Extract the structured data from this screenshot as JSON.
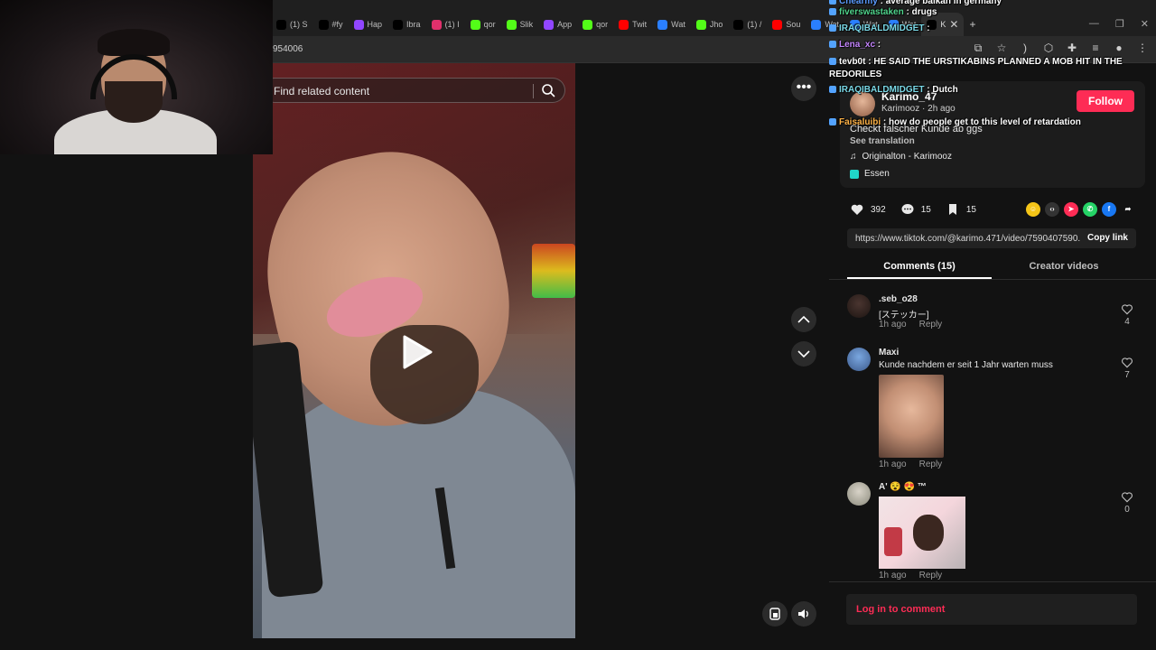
{
  "browser": {
    "tabs": [
      {
        "label": "(1) S",
        "icon": "x-icon",
        "color": "#000000"
      },
      {
        "label": "#fy",
        "icon": "tiktok-icon",
        "color": "#000000"
      },
      {
        "label": "Hap",
        "icon": "twitch-icon",
        "color": "#9146ff"
      },
      {
        "label": "Ibra",
        "icon": "tiktok-icon",
        "color": "#000000"
      },
      {
        "label": "(1) I",
        "icon": "instagram-icon",
        "color": "#e1306c"
      },
      {
        "label": "qor",
        "icon": "kick-icon",
        "color": "#53fc18"
      },
      {
        "label": "Slik",
        "icon": "kick-icon",
        "color": "#53fc18"
      },
      {
        "label": "App",
        "icon": "twitch-icon",
        "color": "#9146ff"
      },
      {
        "label": "qor",
        "icon": "kick-icon",
        "color": "#53fc18"
      },
      {
        "label": "Twit",
        "icon": "youtube-icon",
        "color": "#ff0000"
      },
      {
        "label": "Wat",
        "icon": "globe-icon",
        "color": "#2a7fff"
      },
      {
        "label": "Jho",
        "icon": "kick-icon",
        "color": "#53fc18"
      },
      {
        "label": "(1) /",
        "icon": "x-icon",
        "color": "#000000"
      },
      {
        "label": "Sou",
        "icon": "youtube-icon",
        "color": "#ff0000"
      },
      {
        "label": "Wat",
        "icon": "globe-icon",
        "color": "#2a7fff"
      },
      {
        "label": "Wat",
        "icon": "globe-icon",
        "color": "#2a7fff"
      },
      {
        "label": "Wat",
        "icon": "globe-icon",
        "color": "#2a7fff"
      },
      {
        "label": "K",
        "icon": "tiktok-icon",
        "color": "#000000",
        "active": true
      }
    ],
    "url": "954006"
  },
  "search": {
    "placeholder": "Find related content"
  },
  "post": {
    "author_display": "Karimo_47",
    "author_name": "Karimooz",
    "time_ago": "2h ago",
    "follow_label": "Follow",
    "description": "Checkt falscher Kunde ab ggs",
    "see_translation": "See translation",
    "sound": "Originalton - Karimooz",
    "tag": "Essen",
    "likes": "392",
    "comments": "15",
    "saves": "15",
    "link": "https://www.tiktok.com/@karimo.471/video/7590407590...",
    "copy_link_label": "Copy link"
  },
  "tabs": {
    "comments_label": "Comments (15)",
    "creator_label": "Creator videos"
  },
  "comments": [
    {
      "user": ".seb_o28",
      "text": "[ステッカー]",
      "time": "1h ago",
      "reply": "Reply",
      "likes": "4"
    },
    {
      "user": "Maxi",
      "text": "Kunde nachdem er seit 1 Jahr warten muss",
      "time": "1h ago",
      "reply": "Reply",
      "likes": "7"
    },
    {
      "user": "A' 😵 😍 ™",
      "text": "",
      "time": "1h ago",
      "reply": "Reply",
      "likes": "0"
    }
  ],
  "login": {
    "label": "Log in to comment"
  },
  "chat": [
    {
      "user": "Chearmy",
      "color": "#5b9bff",
      "text": "average balkan in germany"
    },
    {
      "user": "fiverswastaken",
      "color": "#4fd38b",
      "text": "drugs"
    },
    {
      "user": "IRAQIBALDMIDGET",
      "color": "#7ad8e6",
      "text": ""
    },
    {
      "user": "Lena_xc",
      "color": "#c586ff",
      "text": ""
    },
    {
      "user": "tevb0t",
      "color": "#ffffff",
      "text": "HE SAID THE URSTIKABINS PLANNED A MOB HIT IN THE REDORILES"
    },
    {
      "user": "IRAQIBALDMIDGET",
      "color": "#7ad8e6",
      "text": "Dutch"
    },
    {
      "user": "Faisaluibi",
      "color": "#ffb347",
      "text": "how do people get to this level of retardation"
    }
  ]
}
